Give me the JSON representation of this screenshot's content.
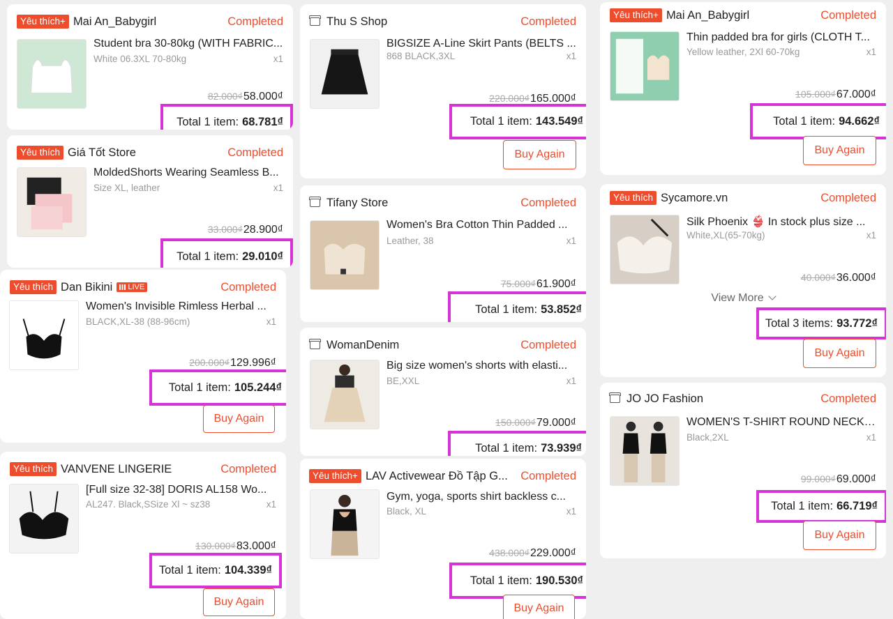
{
  "cards": [
    {
      "badge": "Yêu thích+",
      "shop": "Mai An_Babygirl",
      "status": "Completed",
      "item": "Student bra 30-80kg (WITH FABRIC...",
      "variant": "White 06.3XL 70-80kg",
      "qty": "x1",
      "old_price": "82.000₫",
      "price": "58.000₫",
      "total_label": "Total 1 item:",
      "total_value": "68.781₫"
    },
    {
      "badge": "Yêu thích",
      "shop": "Giá Tốt Store",
      "status": "Completed",
      "item": "MoldedShorts Wearing Seamless B...",
      "variant": "Size XL, leather",
      "qty": "x1",
      "old_price": "33.000₫",
      "price": "28.900₫",
      "total_label": "Total 1 item:",
      "total_value": "29.010₫"
    },
    {
      "badge": "Yêu thích",
      "shop": "Dan Bikini",
      "live": "LIVE",
      "status": "Completed",
      "item": "Women's Invisible Rimless Herbal ...",
      "variant": "BLACK,XL-38 (88-96cm)",
      "qty": "x1",
      "old_price": "200.000₫",
      "price": "129.996₫",
      "total_label": "Total 1 item:",
      "total_value": "105.244₫",
      "buy": "Buy Again"
    },
    {
      "badge": "Yêu thích",
      "shop": "VANVENE LINGERIE",
      "status": "Completed",
      "item": "[Full size 32-38] DORIS AL158 Wo...",
      "variant": "AL247. Black,SSize Xl ~ sz38",
      "qty": "x1",
      "old_price": "130.000₫",
      "price": "83.000₫",
      "total_label": "Total 1 item:",
      "total_value": "104.339₫",
      "buy": "Buy Again"
    },
    {
      "shop": "Thu S Shop",
      "status": "Completed",
      "item": "BIGSIZE A-Line Skirt Pants (BELTS ...",
      "variant": "868 BLACK,3XL",
      "qty": "x1",
      "old_price": "220.000₫",
      "price": "165.000₫",
      "total_label": "Total 1 item:",
      "total_value": "143.549₫",
      "buy": "Buy Again"
    },
    {
      "shop": "Tifany Store",
      "status": "Completed",
      "item": "Women's Bra Cotton Thin Padded ...",
      "variant": "Leather, 38",
      "qty": "x1",
      "old_price": "75.000₫",
      "price": "61.900₫",
      "total_label": "Total 1 item:",
      "total_value": "53.852₫"
    },
    {
      "shop": "WomanDenim",
      "status": "Completed",
      "item": "Big size women's shorts with elasti...",
      "variant": "BE,XXL",
      "qty": "x1",
      "old_price": "150.000₫",
      "price": "79.000₫",
      "total_label": "Total 1 item:",
      "total_value": "73.939₫"
    },
    {
      "badge": "Yêu thích+",
      "shop": "LAV Activewear Đồ Tập G...",
      "status": "Completed",
      "item": "Gym, yoga, sports shirt backless c...",
      "variant": "Black, XL",
      "qty": "x1",
      "old_price": "438.000₫",
      "price": "229.000₫",
      "total_label": "Total 1 item:",
      "total_value": "190.530₫",
      "buy": "Buy Again"
    },
    {
      "badge": "Yêu thích+",
      "shop": "Mai An_Babygirl",
      "status": "Completed",
      "item": "Thin padded bra for girls (CLOTH T...",
      "variant": "Yellow leather, 2Xl 60-70kg",
      "qty": "x1",
      "old_price": "105.000₫",
      "price": "67.000₫",
      "total_label": "Total 1 item:",
      "total_value": "94.662₫",
      "buy": "Buy Again"
    },
    {
      "badge": "Yêu thích",
      "shop": "Sycamore.vn",
      "status": "Completed",
      "item": "Silk Phoenix 👙 In stock plus size ...",
      "variant": "White,XL(65-70kg)",
      "qty": "x1",
      "old_price": "40.000₫",
      "price": "36.000₫",
      "view_more": "View More",
      "total_label": "Total 3 items:",
      "total_value": "93.772₫",
      "buy": "Buy Again"
    },
    {
      "shop": "JO JO Fashion",
      "status": "Completed",
      "item": "WOMEN'S T-SHIRT ROUND NECKL...",
      "variant": "Black,2XL",
      "qty": "x1",
      "old_price": "99.000₫",
      "price": "69.000₫",
      "total_label": "Total 1 item:",
      "total_value": "66.719₫",
      "buy": "Buy Again"
    }
  ],
  "colors": {
    "accent": "#ee4d2d",
    "highlight": "#d633d6"
  }
}
